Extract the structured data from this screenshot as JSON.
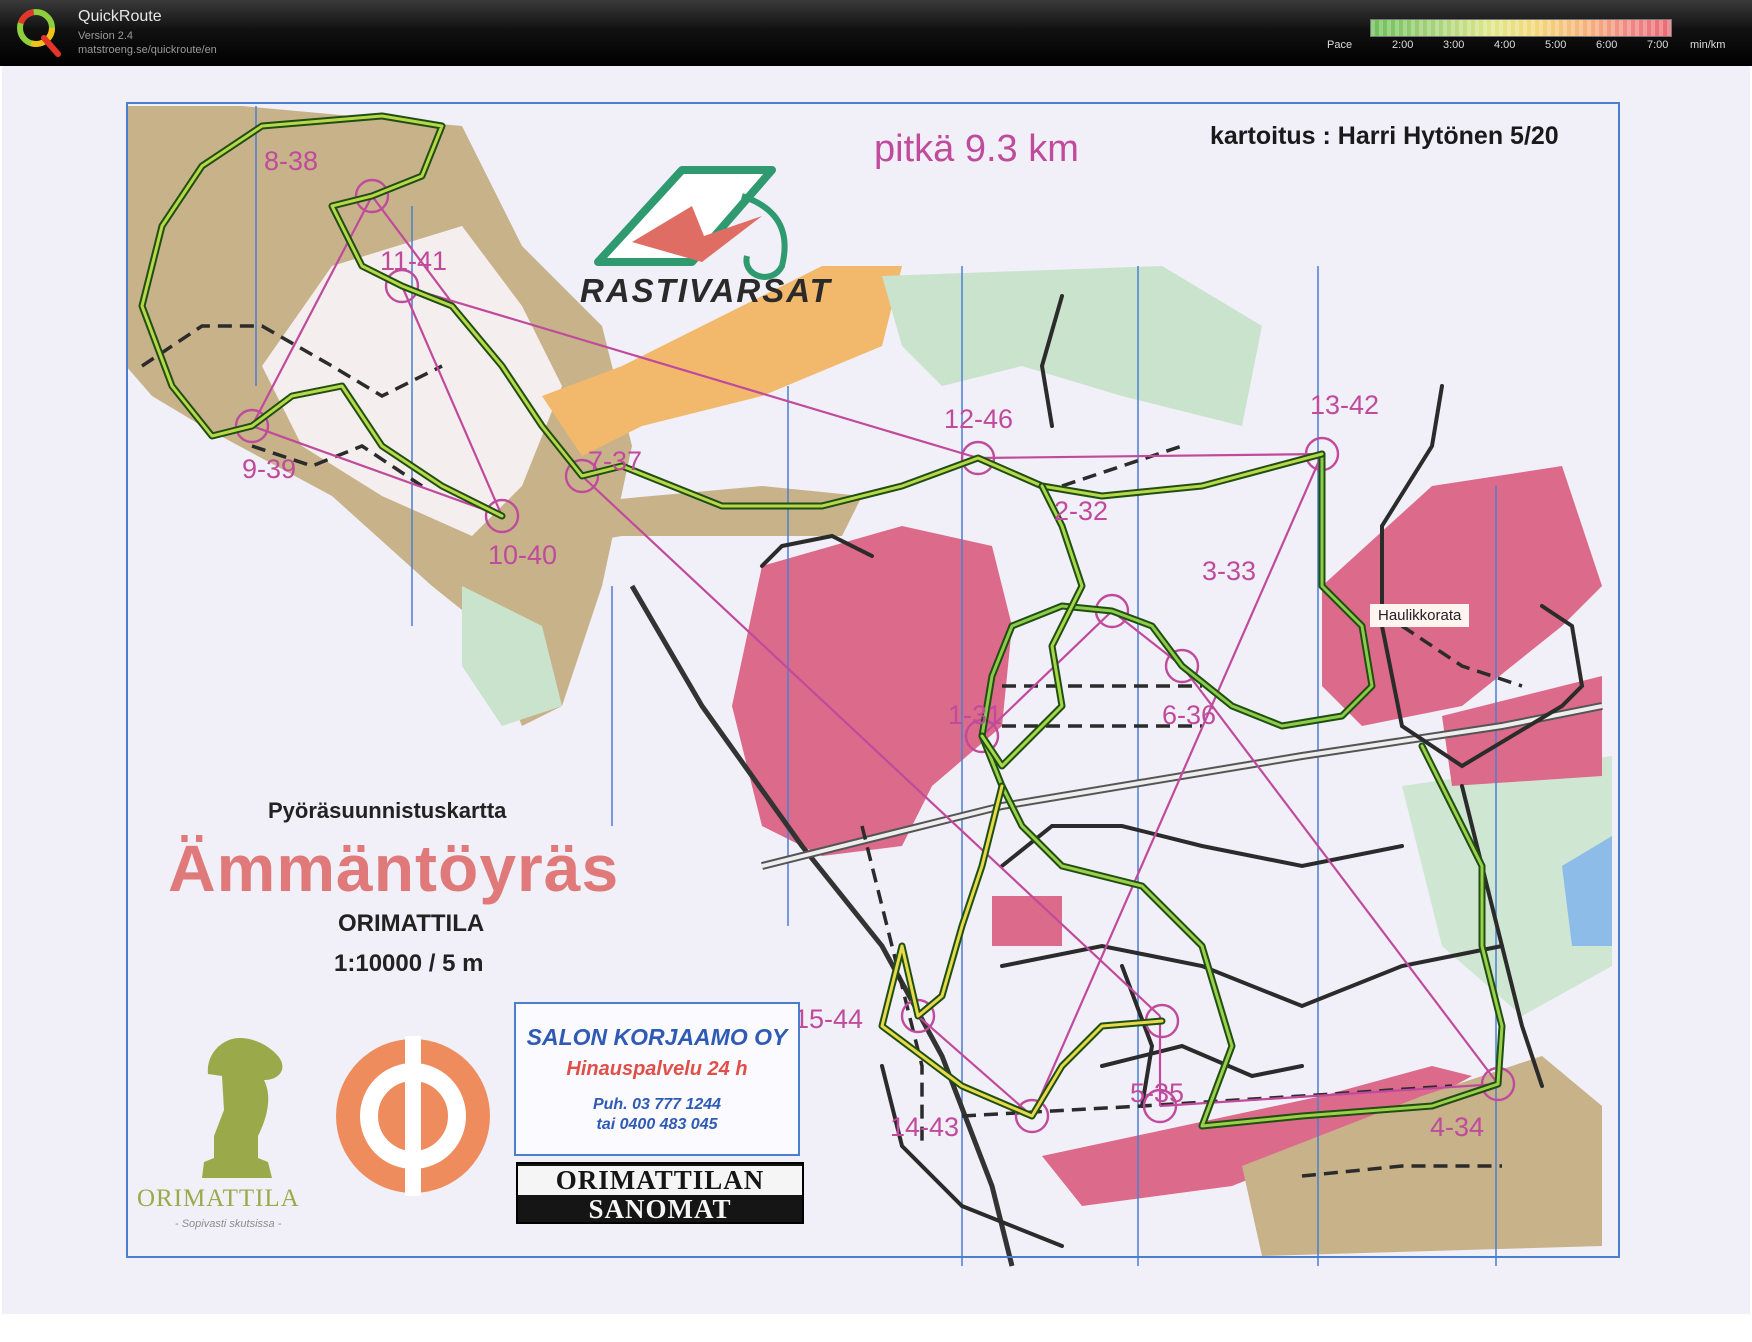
{
  "app": {
    "name": "QuickRoute",
    "version": "Version 2.4",
    "url": "matstroeng.se/quickroute/en"
  },
  "pace_legend": {
    "label": "Pace",
    "ticks": [
      "2:00",
      "3:00",
      "4:00",
      "5:00",
      "6:00",
      "7:00"
    ],
    "unit": "min/km",
    "colors": [
      "#6cbf5a",
      "#dfe78a",
      "#f5b27b",
      "#e86a74"
    ]
  },
  "map": {
    "course_length": "pitkä 9.3 km",
    "credits": "kartoitus : Harri Hytönen 5/20",
    "subtitle": "Pyöräsuunnistuskartta",
    "title": "Ämmäntöyräs",
    "town": "ORIMATTILA",
    "scale": "1:10000 / 5 m",
    "brand": "RASTIVARSAT",
    "place_label": "Haulikkorata",
    "controls": [
      "1-31",
      "2-32",
      "3-33",
      "4-34",
      "5-35",
      "6-36",
      "7-37",
      "8-38",
      "9-39",
      "10-40",
      "11-41",
      "12-46",
      "13-42",
      "14-43",
      "15-44"
    ],
    "colors": {
      "course": "#c04a9c",
      "route": "#2e6d1e",
      "north_lines": "#4a7fd0",
      "frame": "#4a7fd0"
    }
  },
  "sponsors": {
    "garage_name": "SALON KORJAAMO OY",
    "garage_service": "Hinauspalvelu 24 h",
    "garage_phone": "Puh. 03 777 1244",
    "garage_phone2": "tai 0400 483 045",
    "newspaper_line1": "ORIMATTILAN",
    "newspaper_line2": "SANOMAT",
    "town_logo": "ORIMATTILA",
    "town_slogan": "- Sopivasti skutsissa -"
  }
}
